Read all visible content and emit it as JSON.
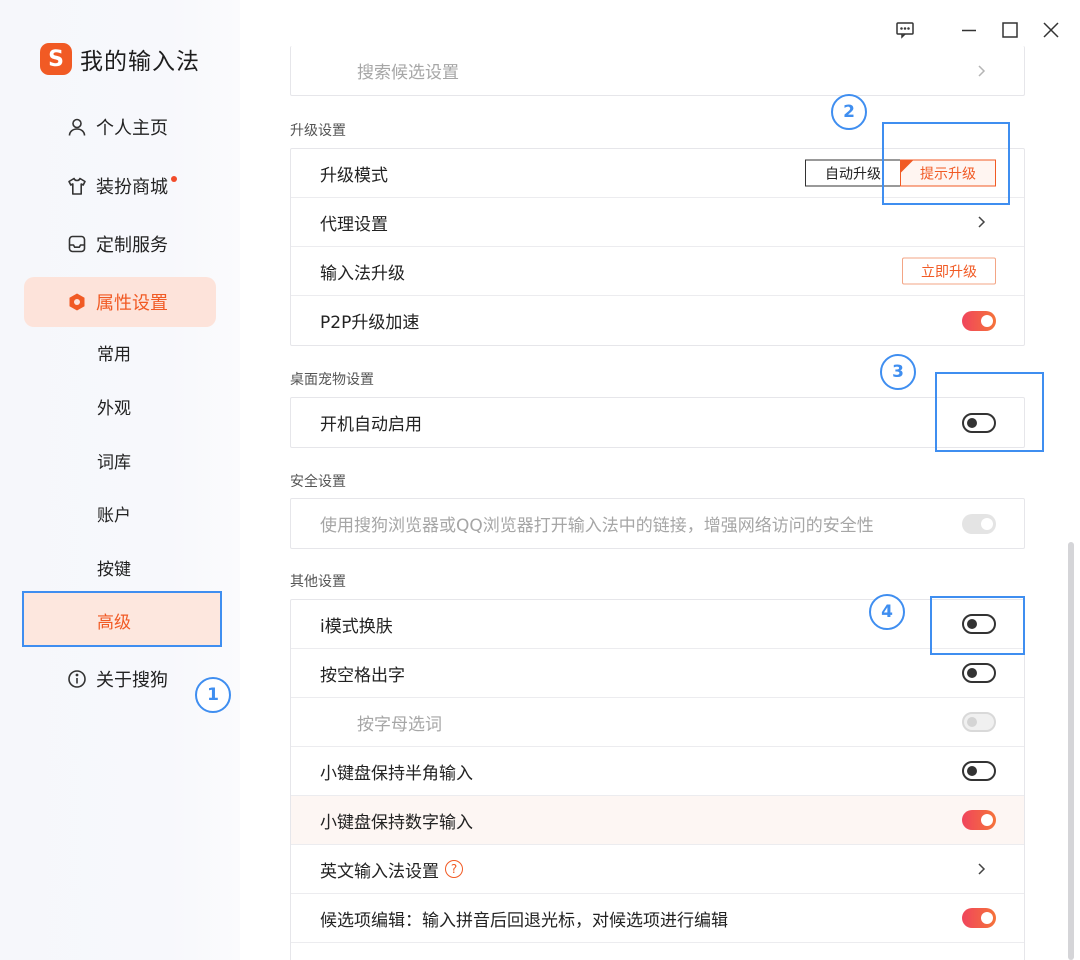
{
  "app": {
    "title": "我的输入法",
    "logo_letter": "S",
    "brand_color": "#f15a24"
  },
  "sidebar": {
    "items": [
      {
        "label": "个人主页",
        "icon": "person-icon"
      },
      {
        "label": "装扮商城",
        "icon": "shirt-icon",
        "dot": true
      },
      {
        "label": "定制服务",
        "icon": "inbox-icon"
      },
      {
        "label": "属性设置",
        "icon": "hexagon-icon",
        "active": true
      },
      {
        "label": "关于搜狗",
        "icon": "info-icon"
      }
    ],
    "sub_items": [
      {
        "label": "常用"
      },
      {
        "label": "外观"
      },
      {
        "label": "词库"
      },
      {
        "label": "账户"
      },
      {
        "label": "按键"
      },
      {
        "label": "高级",
        "active": true
      }
    ]
  },
  "annotations": [
    "1",
    "2",
    "3",
    "4"
  ],
  "content": {
    "search_row": {
      "label": "搜索候选设置"
    },
    "upgrade": {
      "title": "升级设置",
      "mode_label": "升级模式",
      "mode_options": [
        "自动升级",
        "提示升级"
      ],
      "mode_selected": "提示升级",
      "proxy_label": "代理设置",
      "ime_upgrade_label": "输入法升级",
      "ime_upgrade_button": "立即升级",
      "p2p_label": "P2P升级加速",
      "p2p_on": true
    },
    "pet": {
      "title": "桌面宠物设置",
      "autostart_label": "开机自动启用",
      "autostart_on": false
    },
    "security": {
      "title": "安全设置",
      "browser_label": "使用搜狗浏览器或QQ浏览器打开输入法中的链接，增强网络访问的安全性",
      "browser_on": true,
      "disabled": true
    },
    "other": {
      "title": "其他设置",
      "rows": [
        {
          "label": "i模式换肤",
          "state": "off"
        },
        {
          "label": "按空格出字",
          "state": "off"
        },
        {
          "label": "按字母选词",
          "state": "disabled"
        },
        {
          "label": "小键盘保持半角输入",
          "state": "off"
        },
        {
          "label": "小键盘保持数字输入",
          "state": "on"
        },
        {
          "label": "英文输入法设置",
          "state": "chevron",
          "help": "?"
        },
        {
          "label": "候选项编辑：输入拼音后回退光标，对候选项进行编辑",
          "state": "on"
        }
      ]
    }
  }
}
